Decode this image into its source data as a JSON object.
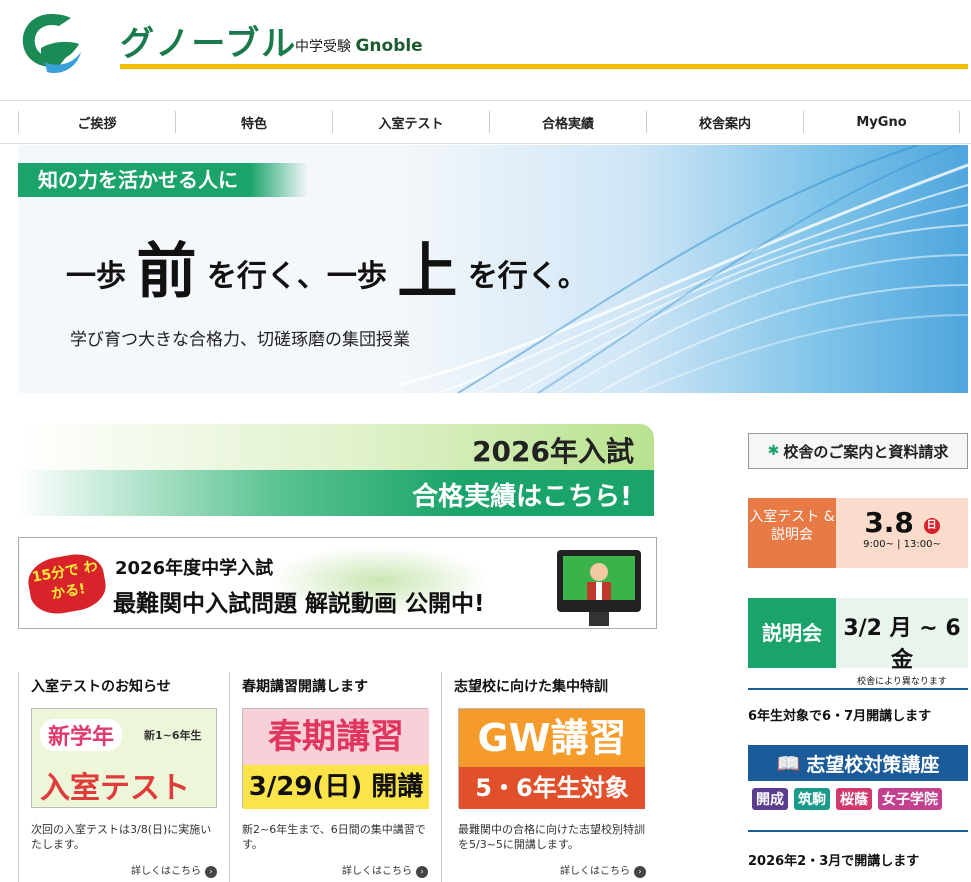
{
  "header": {
    "brand": "グノーブル",
    "tagline_prefix": "中学受験",
    "tagline_name": "Gnoble"
  },
  "nav": [
    "ご挨拶",
    "特色",
    "入室テスト",
    "合格実績",
    "校舎案内",
    "MyGno"
  ],
  "hero": {
    "tag": "知の力を活かせる人に",
    "main_a": "一歩",
    "main_b": "前",
    "main_c": "を行く、一歩",
    "main_d": "上",
    "main_e": "を行く。",
    "sub": "学び育つ大きな合格力、切磋琢磨の集団授業"
  },
  "results": {
    "line1": "2026年入試",
    "line2": "合格実績はこちら!"
  },
  "video": {
    "burst": "15分で わかる!",
    "line1": "2026年度中学入試",
    "line2": "最難関中入試問題 解説動画 公開中!"
  },
  "columns": [
    {
      "title": "入室テストのお知らせ",
      "img_a": "新学年",
      "img_b": "新1~6年生",
      "img_c": "入室テスト",
      "text": "次回の入室テストは3/8(日)に実施いたします。",
      "more": "詳しくはこちら"
    },
    {
      "title": "春期講習開講します",
      "img_a": "春期講習",
      "img_b": "3/29(日) 開講",
      "text": "新2~6年生まで、6日間の集中講習です。",
      "more": "詳しくはこちら"
    },
    {
      "title": "志望校に向けた集中特訓",
      "img_a": "GW講習",
      "img_b": "5・6年生対象",
      "text": "最難関中の合格に向けた志望校別特訓を5/3~5に開講します。",
      "more": "詳しくはこちら"
    }
  ],
  "sidebar": {
    "campus_btn": "校舎のご案内と資料請求",
    "test_label": "入室テスト & 説明会",
    "test_date": "3.8",
    "test_day": "日",
    "test_time": "9:00~ | 13:00~",
    "setsu_label": "説明会",
    "setsu_date": "3/2 月 ~ 6 金",
    "setsu_note": "校舎により異なります",
    "text1": "6年生対象で6・7月開講します",
    "shibou": "志望校対策講座",
    "schools": [
      "開成",
      "筑駒",
      "桜蔭",
      "女子学院"
    ],
    "text2": "2026年2・3月で開講します"
  },
  "colors": {
    "brand_green": "#1b7a4c",
    "accent_green": "#1aa36a",
    "gold": "#f0c000",
    "blue": "#1b5b9a",
    "orange": "#e77a45"
  }
}
